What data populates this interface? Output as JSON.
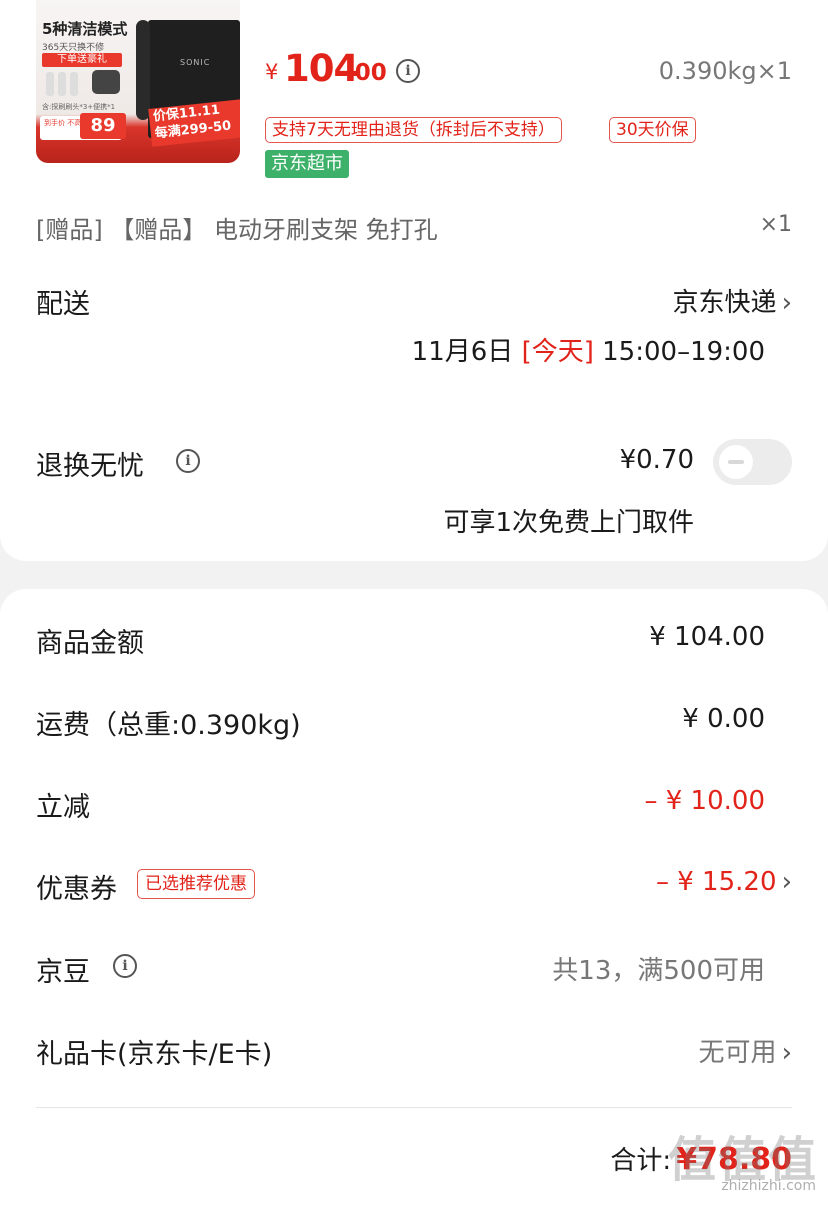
{
  "product": {
    "thumb": {
      "line1": "5种清洁模式",
      "line2": "365天只换不修",
      "gift_label": "下单送豪礼",
      "small_text": "含:探刷刷头*3+便携*1",
      "price_label": "到手价 不高于",
      "price": "89",
      "brand": "SONIC",
      "promo_line1": "价保11.11",
      "promo_line2": "每满299-50"
    },
    "price_symbol": "¥",
    "price_integer": "104",
    "price_decimal": ".00",
    "weight_qty": "0.390kg×1",
    "tags": [
      "支持7天无理由退货（拆封后不支持）",
      "30天价保"
    ],
    "store_tag": "京东超市"
  },
  "gift": {
    "text": "[赠品] 【赠品】 电动牙刷支架 免打孔",
    "qty": "×1"
  },
  "delivery": {
    "label": "配送",
    "method": "京东快递",
    "date": "11月6日",
    "today": "[今天]",
    "time": "15:00–19:00"
  },
  "return_insurance": {
    "label": "退换无忧",
    "price": "¥0.70",
    "desc": "可享1次免费上门取件",
    "enabled": false
  },
  "summary": {
    "goods_label": "商品金额",
    "goods_value": "¥ 104.00",
    "shipping_label": "运费（总重:0.390kg)",
    "shipping_value": "¥ 0.00",
    "discount_label": "立减",
    "discount_value": "– ¥ 10.00",
    "coupon_label": "优惠券",
    "coupon_tag": "已选推荐优惠",
    "coupon_value": "– ¥ 15.20",
    "beans_label": "京豆",
    "beans_value": "共13，满500可用",
    "giftcard_label": "礼品卡(京东卡/E卡)",
    "giftcard_value": "无可用",
    "total_label": "合计:",
    "total_value": "¥78.80"
  },
  "watermark": {
    "text": "值值值",
    "url": "zhizhizhi.com"
  },
  "icons": {
    "info": "info-circle-icon",
    "chevron": "chevron-right-icon"
  },
  "colors": {
    "accent_red": "#e2231a",
    "store_green": "#3db16a"
  }
}
